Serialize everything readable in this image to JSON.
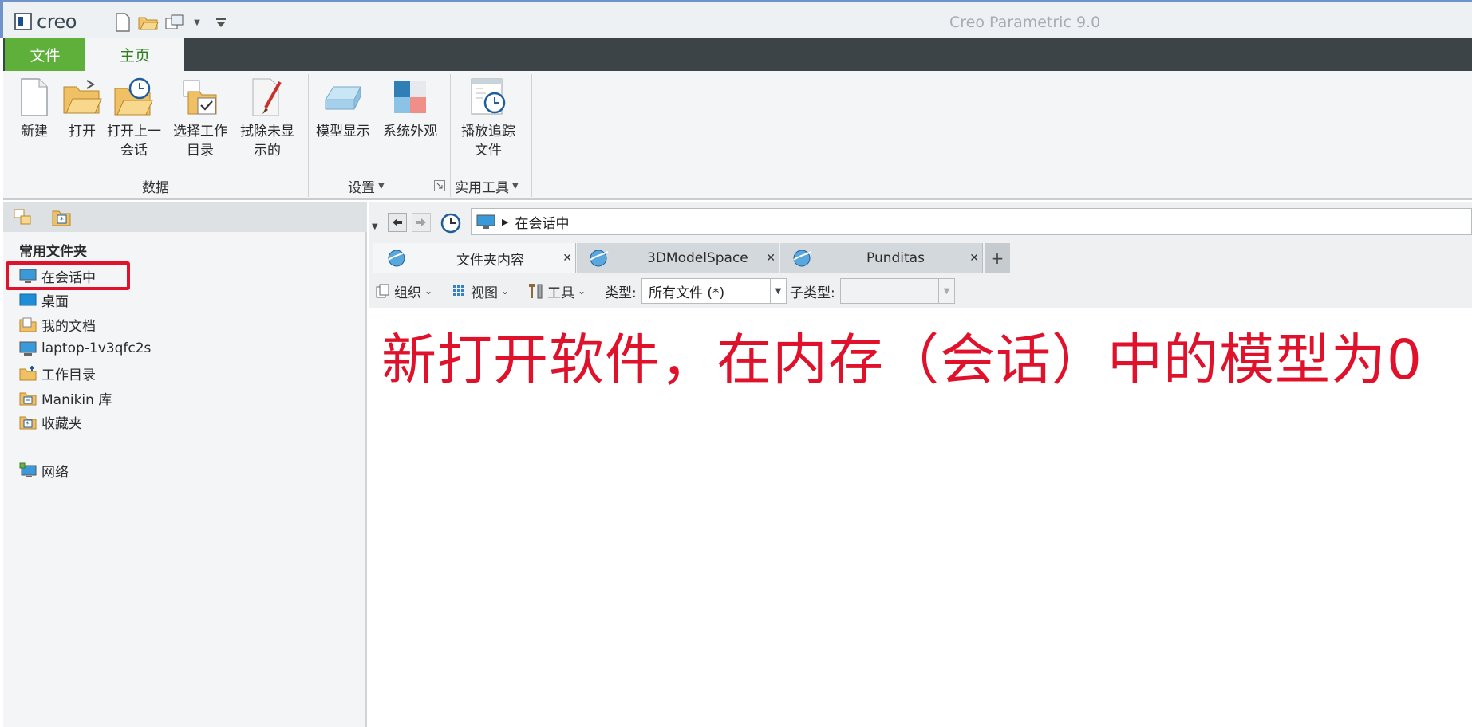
{
  "titlebar": {
    "logo_text": "creo",
    "app_title": "Creo Parametric 9.0",
    "quick_access": [
      "new-icon",
      "open-icon",
      "window-icon",
      "dropdown-icon",
      "customize-icon"
    ]
  },
  "ribbon_tabs": {
    "file": "文件",
    "home": "主页"
  },
  "ribbon": {
    "buttons": {
      "new": "新建",
      "open": "打开",
      "open_last_line1": "打开上一",
      "open_last_line2": "会话",
      "select_wd_line1": "选择工作",
      "select_wd_line2": "目录",
      "erase_line1": "拭除未显",
      "erase_line2": "示的",
      "model_display": "模型显示",
      "system_appearance": "系统外观",
      "playback_line1": "播放追踪",
      "playback_line2": "文件"
    },
    "groups": {
      "data": "数据",
      "settings": "设置",
      "utilities": "实用工具"
    }
  },
  "left_pane": {
    "heading": "常用文件夹",
    "items": [
      "在会话中",
      "桌面",
      "我的文档",
      "laptop-1v3qfc2s",
      "工作目录",
      "Manikin 库",
      "收藏夹",
      "网络"
    ]
  },
  "browser": {
    "address": "在会话中",
    "tabs": [
      "文件夹内容",
      "3DModelSpace",
      "Punditas"
    ],
    "add_tab": "+",
    "toolbar": {
      "organize": "组织",
      "view": "视图",
      "tools": "工具",
      "type_label": "类型:",
      "type_value": "所有文件 (*)",
      "subtype_label": "子类型:",
      "subtype_value": ""
    },
    "annotation": "新打开软件，在内存（会话）中的模型为0"
  },
  "colors": {
    "accent_red": "#e0112b",
    "file_tab_green": "#5faf3b",
    "home_tab_text": "#2f7d1f"
  }
}
